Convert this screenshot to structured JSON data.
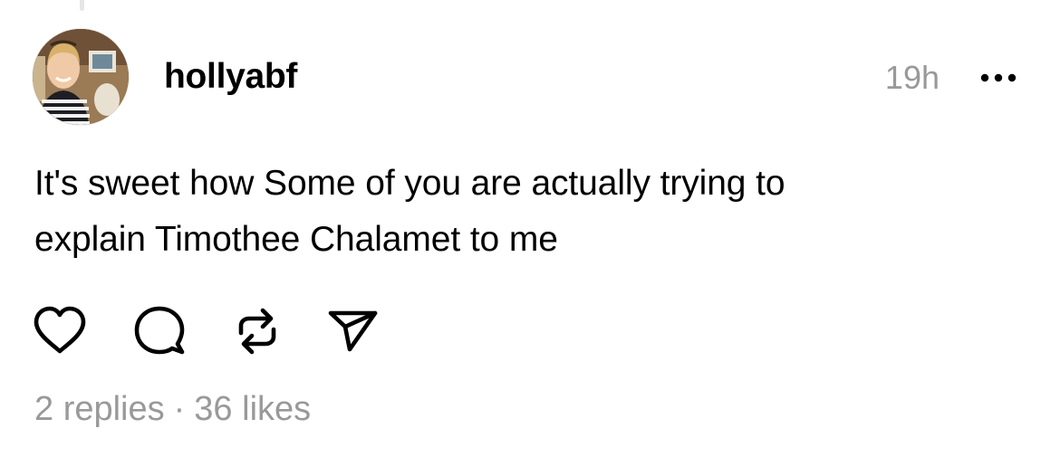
{
  "post": {
    "username": "hollyabf",
    "timestamp": "19h",
    "text_line1": "It's sweet how Some of you are actually trying to",
    "text_line2": "explain Timothee Chalamet to me",
    "replies": "2 replies",
    "separator": "·",
    "likes": "36 likes"
  },
  "icons": {
    "avatar": "profile-photo",
    "more": "more-horizontal-icon",
    "like": "heart-icon",
    "reply": "comment-icon",
    "repost": "repost-icon",
    "share": "send-icon"
  },
  "colors": {
    "text": "#000000",
    "secondary_text": "#999999",
    "background": "#ffffff"
  }
}
